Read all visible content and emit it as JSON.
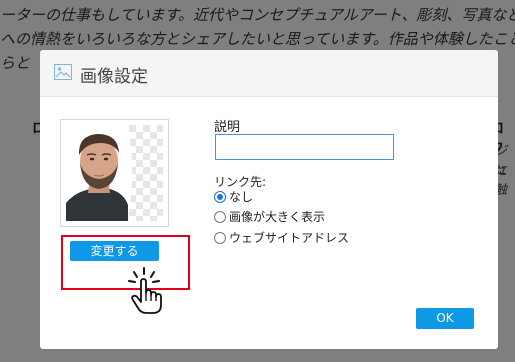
{
  "background": {
    "line1": "ーターの仕事もしています。近代やコンセプチュアルアート、彫刻、写真などに興",
    "line2": "への情熱をいろいろな方とシェアしたいと思っています。作品や体験したことだ",
    "line3": "らと",
    "heading_left": "ロ",
    "heading_right": "ロフ",
    "right_text_1": "ジュ",
    "right_text_2": "に触"
  },
  "dialog": {
    "title": "画像設定",
    "title_icon": "image-icon",
    "change_button_label": "変更する",
    "description_label": "説明",
    "description_value": "",
    "link_label": "リンク先:",
    "link_options": [
      {
        "label": "なし",
        "checked": true
      },
      {
        "label": "画像が大きく表示",
        "checked": false
      },
      {
        "label": "ウェブサイトアドレス",
        "checked": false
      }
    ],
    "ok_label": "OK"
  },
  "colors": {
    "accent": "#0e98e6",
    "highlight": "#e0001a"
  }
}
